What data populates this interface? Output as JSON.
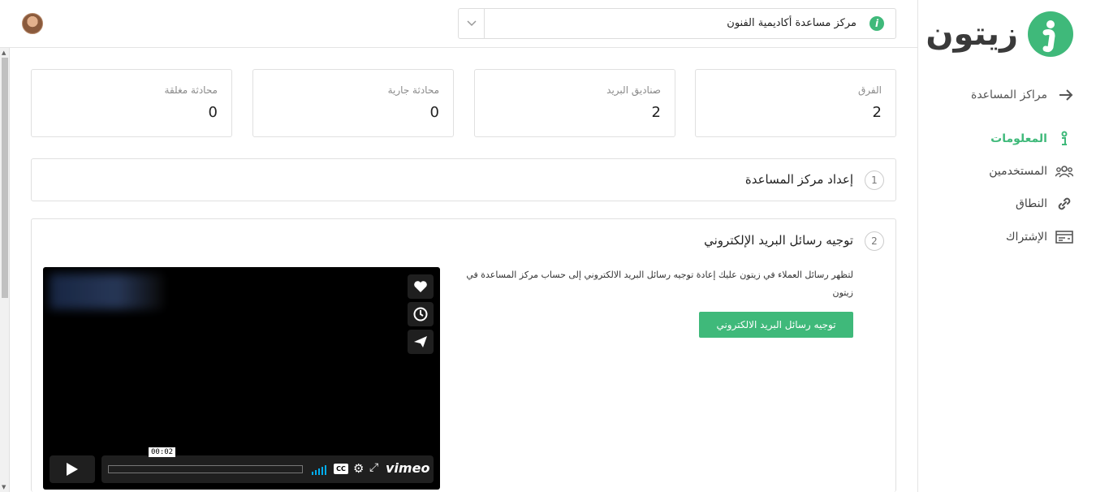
{
  "sidebar": {
    "logo_text": "زيتون",
    "back_label": "مراكز المساعدة",
    "items": [
      {
        "label": "المعلومات",
        "icon": "info-icon",
        "active": true
      },
      {
        "label": "المستخدمين",
        "icon": "users-icon",
        "active": false
      },
      {
        "label": "النطاق",
        "icon": "link-icon",
        "active": false
      },
      {
        "label": "الإشتراك",
        "icon": "billing-icon",
        "active": false
      }
    ]
  },
  "header": {
    "help_center_name": "مركز مساعدة أكاديمية الفنون"
  },
  "stats": [
    {
      "title": "الفرق",
      "value": "2"
    },
    {
      "title": "صناديق البريد",
      "value": "2"
    },
    {
      "title": "محادثة جارية",
      "value": "0"
    },
    {
      "title": "محادثة مغلقة",
      "value": "0"
    }
  ],
  "steps": [
    {
      "num": "1",
      "title": "إعداد مركز المساعدة"
    },
    {
      "num": "2",
      "title": "توجيه رسائل البريد الإلكتروني",
      "description": "لتظهر رسائل العملاء في زيتون عليك إعادة توجيه رسائل البريد الالكتروني إلى حساب مركز المساعدة في زيتون",
      "button_label": "توجيه رسائل البريد الالكتروني"
    }
  ],
  "video": {
    "time": "00:02",
    "brand": "vimeo",
    "cc_label": "CC"
  },
  "colors": {
    "accent": "#3fb97a",
    "arrow": "#6aa84f"
  }
}
